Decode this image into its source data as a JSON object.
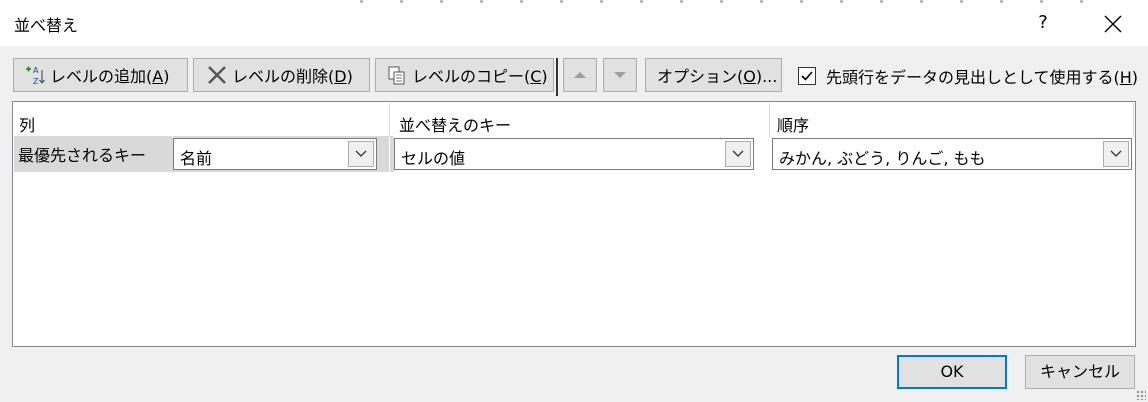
{
  "dialog": {
    "title": "並べ替え",
    "help": "?"
  },
  "toolbar": {
    "add_level": {
      "text": "レベルの追加(",
      "key": "A",
      "end": ")"
    },
    "delete_level": {
      "text": "レベルの削除(",
      "key": "D",
      "end": ")"
    },
    "copy_level": {
      "text": "レベルのコピー(",
      "key": "C",
      "end": ")"
    },
    "options": {
      "text": "オプション(",
      "key": "O",
      "end": ")..."
    },
    "header_checkbox": {
      "text": "先頭行をデータの見出しとして使用する(",
      "key": "H",
      "end": ")",
      "checked": true
    }
  },
  "grid": {
    "headers": {
      "column": "列",
      "sort_on": "並べ替えのキー",
      "order": "順序"
    },
    "rows": [
      {
        "label": "最優先されるキー",
        "column_value": "名前",
        "sort_on_value": "セルの値",
        "order_value": "みかん, ぶどう, りんご, もも"
      }
    ]
  },
  "footer": {
    "ok": "OK",
    "cancel": "キャンセル"
  },
  "colors": {
    "focus_border": "#0078d7",
    "row_label_bg": "#d9d9d9"
  }
}
